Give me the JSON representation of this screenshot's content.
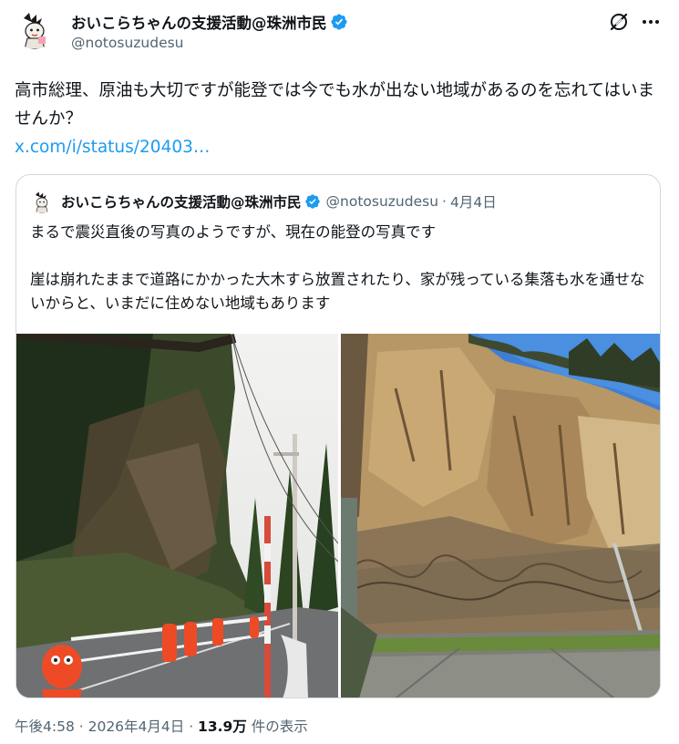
{
  "author": {
    "display_name": "おいこらちゃんの支援活動@珠洲市民",
    "handle": "@notosuzudesu"
  },
  "tweet": {
    "text": "高市総理、原油も大切ですが能登では今でも水が出ない地域があるのを忘れてはいませんか？",
    "link": "x.com/i/status/20403…"
  },
  "quote": {
    "display_name": "おいこらちゃんの支援活動@珠洲市民",
    "handle": "@notosuzudesu",
    "separator": "·",
    "date": "4月4日",
    "line1": "まるで震災直後の写真のようですが、現在の能登の写真です",
    "line2": "崖は崩れたままで道路にかかった大木すら放置されたり、家が残っている集落も水を通せないからと、いまだに住めない地域もあります"
  },
  "meta": {
    "time": "午後4:58",
    "separator1": " · ",
    "date": "2026年4月4日",
    "separator2": " · ",
    "views_count": "13.9万",
    "views_label": " 件の表示"
  },
  "icons": {
    "verified": "verified-badge-icon",
    "grok": "grok-icon",
    "more": "more-options-icon"
  },
  "colors": {
    "link": "#1d9bf0",
    "verified": "#1d9bf0",
    "secondary_text": "#536471"
  }
}
